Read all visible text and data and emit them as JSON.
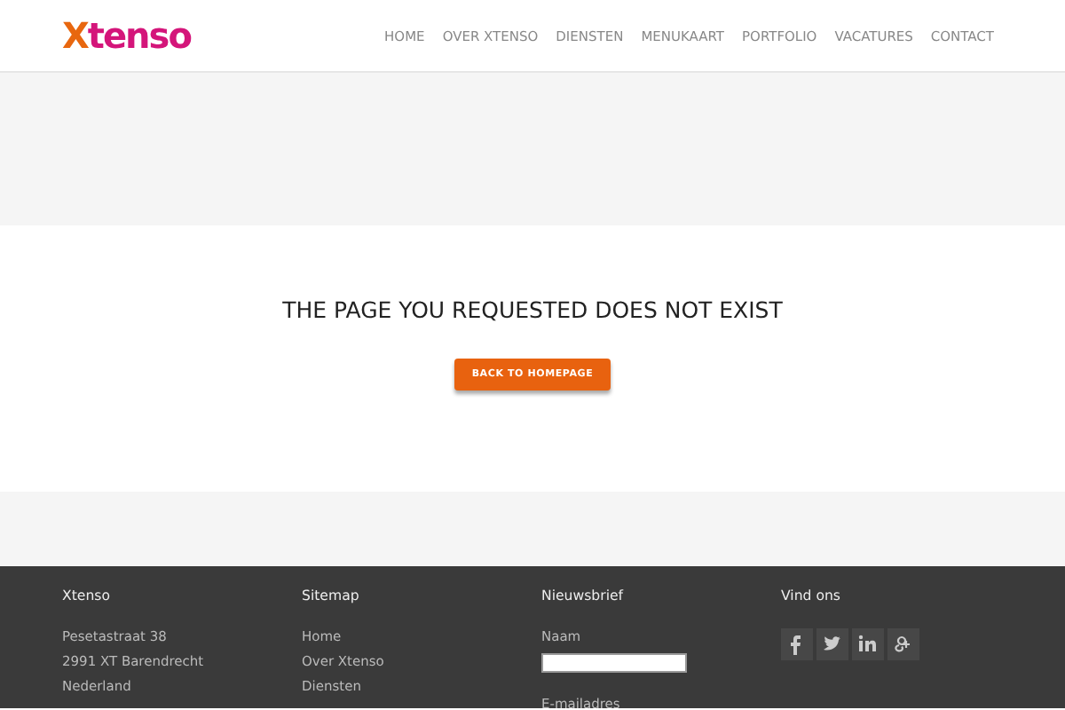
{
  "header": {
    "logo": {
      "first": "X",
      "rest": "tenso"
    },
    "nav": [
      {
        "label": "HOME"
      },
      {
        "label": "OVER XTENSO"
      },
      {
        "label": "DIENSTEN"
      },
      {
        "label": "MENUKAART"
      },
      {
        "label": "PORTFOLIO"
      },
      {
        "label": "VACATURES"
      },
      {
        "label": "CONTACT"
      }
    ]
  },
  "message": {
    "heading": "THE PAGE YOU REQUESTED DOES NOT EXIST",
    "button": "BACK TO HOMEPAGE"
  },
  "footer": {
    "columns": [
      {
        "kind": "text",
        "title": "Xtenso",
        "lines": [
          "Pesetastraat 38",
          "2991 XT Barendrecht",
          "Nederland"
        ]
      },
      {
        "kind": "links",
        "title": "Sitemap",
        "lines": [
          "Home",
          "Over Xtenso",
          "Diensten"
        ]
      },
      {
        "kind": "form",
        "title": "Nieuwsbrief",
        "fields": [
          {
            "kind": "labeled_input",
            "label": "Naam"
          },
          {
            "kind": "label_only",
            "label": "E-mailadres"
          }
        ]
      },
      {
        "kind": "social",
        "title": "Vind ons",
        "icons": [
          {
            "kind": "facebook"
          },
          {
            "kind": "twitter"
          },
          {
            "kind": "linkedin"
          },
          {
            "kind": "googleplus"
          }
        ]
      }
    ]
  }
}
